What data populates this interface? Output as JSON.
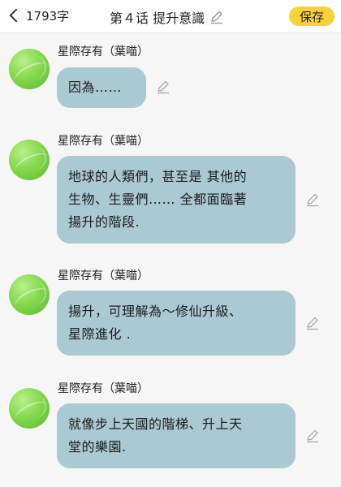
{
  "header": {
    "back_label": "1793字",
    "title": "第４话 提升意識",
    "save_label": "保存"
  },
  "messages": [
    {
      "author": "星際存有（葉喵）",
      "lines": [
        "因為……"
      ]
    },
    {
      "author": "星際存有（葉喵）",
      "lines": [
        "地球的人類們，甚至是 其他的",
        "生物、生靈們…… 全都面臨著",
        "揚升的階段."
      ]
    },
    {
      "author": "星際存有（葉喵）",
      "lines": [
        "揚升，可理解為～修仙升級、",
        "星際進化 ."
      ]
    },
    {
      "author": "星際存有（葉喵）",
      "lines": [
        "就像步上天國的階梯、升上天",
        "堂的樂園."
      ]
    }
  ],
  "icons": {
    "back": "chevron-left-icon",
    "edit": "pencil-icon",
    "avatar": "green-leaf-avatar"
  },
  "colors": {
    "save_button": "#f7d23d",
    "bubble": "#aac9d3",
    "background": "#f6f6f7"
  }
}
